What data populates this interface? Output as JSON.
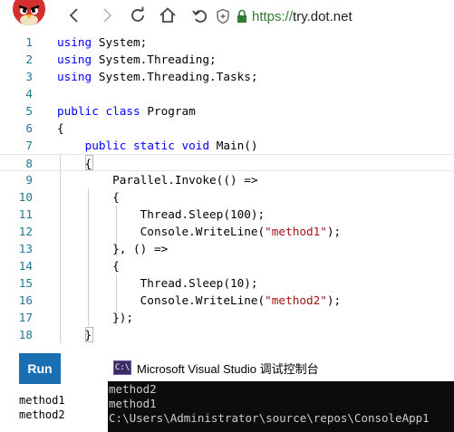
{
  "browser": {
    "url_scheme": "https://",
    "url_host": "try.dot.net",
    "icons": {
      "back": "chevron-left-icon",
      "forward": "chevron-right-icon",
      "refresh": "refresh-icon",
      "home": "home-icon",
      "undo": "undo-icon",
      "shield": "shield-icon",
      "lock": "lock-icon"
    }
  },
  "editor": {
    "lines": [
      {
        "n": "1",
        "parts": [
          {
            "t": "using",
            "c": "kw"
          },
          {
            "t": " System;",
            "c": ""
          }
        ]
      },
      {
        "n": "2",
        "parts": [
          {
            "t": "using",
            "c": "kw"
          },
          {
            "t": " System.Threading;",
            "c": ""
          }
        ]
      },
      {
        "n": "3",
        "parts": [
          {
            "t": "using",
            "c": "kw"
          },
          {
            "t": " System.Threading.Tasks;",
            "c": ""
          }
        ]
      },
      {
        "n": "4",
        "parts": []
      },
      {
        "n": "5",
        "parts": [
          {
            "t": "public",
            "c": "kw"
          },
          {
            "t": " ",
            "c": ""
          },
          {
            "t": "class",
            "c": "kw"
          },
          {
            "t": " Program",
            "c": ""
          }
        ]
      },
      {
        "n": "6",
        "parts": [
          {
            "t": "{",
            "c": ""
          }
        ]
      },
      {
        "n": "7",
        "parts": [
          {
            "t": "    ",
            "c": ""
          },
          {
            "t": "public",
            "c": "kw"
          },
          {
            "t": " ",
            "c": ""
          },
          {
            "t": "static",
            "c": "kw"
          },
          {
            "t": " ",
            "c": ""
          },
          {
            "t": "void",
            "c": "kw"
          },
          {
            "t": " Main()",
            "c": ""
          }
        ]
      },
      {
        "n": "8",
        "parts": [
          {
            "t": "    {",
            "c": ""
          }
        ]
      },
      {
        "n": "9",
        "parts": [
          {
            "t": "        Parallel.Invoke(() =>",
            "c": ""
          }
        ]
      },
      {
        "n": "10",
        "parts": [
          {
            "t": "        {",
            "c": ""
          }
        ]
      },
      {
        "n": "11",
        "parts": [
          {
            "t": "            Thread.Sleep(100);",
            "c": ""
          }
        ]
      },
      {
        "n": "12",
        "parts": [
          {
            "t": "            Console.WriteLine(",
            "c": ""
          },
          {
            "t": "\"method1\"",
            "c": "str"
          },
          {
            "t": ");",
            "c": ""
          }
        ]
      },
      {
        "n": "13",
        "parts": [
          {
            "t": "        }, () =>",
            "c": ""
          }
        ]
      },
      {
        "n": "14",
        "parts": [
          {
            "t": "        {",
            "c": ""
          }
        ]
      },
      {
        "n": "15",
        "parts": [
          {
            "t": "            Thread.Sleep(10);",
            "c": ""
          }
        ]
      },
      {
        "n": "16",
        "parts": [
          {
            "t": "            Console.WriteLine(",
            "c": ""
          },
          {
            "t": "\"method2\"",
            "c": "str"
          },
          {
            "t": ");",
            "c": ""
          }
        ]
      },
      {
        "n": "17",
        "parts": [
          {
            "t": "        });",
            "c": ""
          }
        ]
      },
      {
        "n": "18",
        "parts": [
          {
            "t": "    }",
            "c": ""
          }
        ]
      }
    ]
  },
  "run_button": {
    "label": "Run"
  },
  "output": {
    "lines": [
      "method1",
      "method2"
    ]
  },
  "console": {
    "title": "Microsoft Visual Studio 调试控制台",
    "icon_label": "C:\\",
    "lines": [
      "method2",
      "method1",
      "",
      "C:\\Users\\Administrator\\source\\repos\\ConsoleApp1"
    ]
  },
  "colors": {
    "keyword": "#0000ff",
    "string": "#a31515",
    "line_number": "#237893",
    "url_green": "#2e7d32",
    "run_button": "#1a6fb3",
    "console_bg": "#0c0c0c"
  }
}
